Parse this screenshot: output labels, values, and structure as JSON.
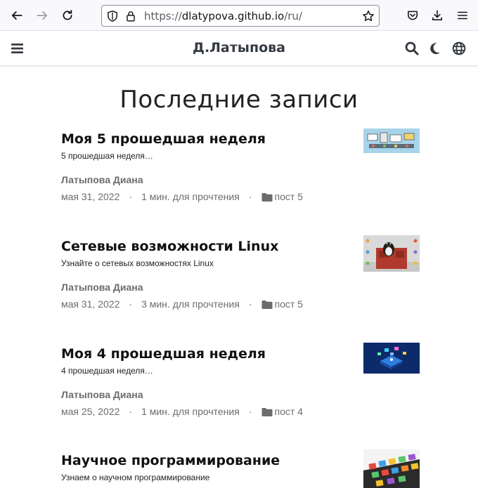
{
  "browser": {
    "url_prefix": "https://",
    "url_host": "dlatypova.github.io",
    "url_path": "/ru/"
  },
  "site": {
    "title": "Д.Латыпова"
  },
  "main": {
    "heading": "Последние записи",
    "posts": [
      {
        "title": "Моя 5 прошедшая неделя",
        "excerpt": "5 прошедшая неделя…",
        "author": "Латыпова Диана",
        "date": "мая 31, 2022",
        "read_time": "1 мин. для прочтения",
        "category": "пост 5",
        "thumbnail": "week-5-thumbnail"
      },
      {
        "title": "Сетевые возможности Linux",
        "excerpt": "Узнайте о сетевых возможностях Linux",
        "author": "Латыпова Диана",
        "date": "мая 31, 2022",
        "read_time": "3 мин. для прочтения",
        "category": "пост 5",
        "thumbnail": "linux-penguin-thumbnail"
      },
      {
        "title": "Моя 4 прошедшая неделя",
        "excerpt": "4 прошедшая неделя…",
        "author": "Латыпова Диана",
        "date": "мая 25, 2022",
        "read_time": "1 мин. для прочтения",
        "category": "пост 4",
        "thumbnail": "week-4-thumbnail"
      },
      {
        "title": "Научное программирование",
        "excerpt": "Узнаем о научном программирование",
        "thumbnail": "scientific-programming-thumbnail"
      }
    ],
    "meta_separator": "·"
  },
  "colors": {
    "meta_gray": "#6c6c6c",
    "header_text": "#343a40"
  }
}
